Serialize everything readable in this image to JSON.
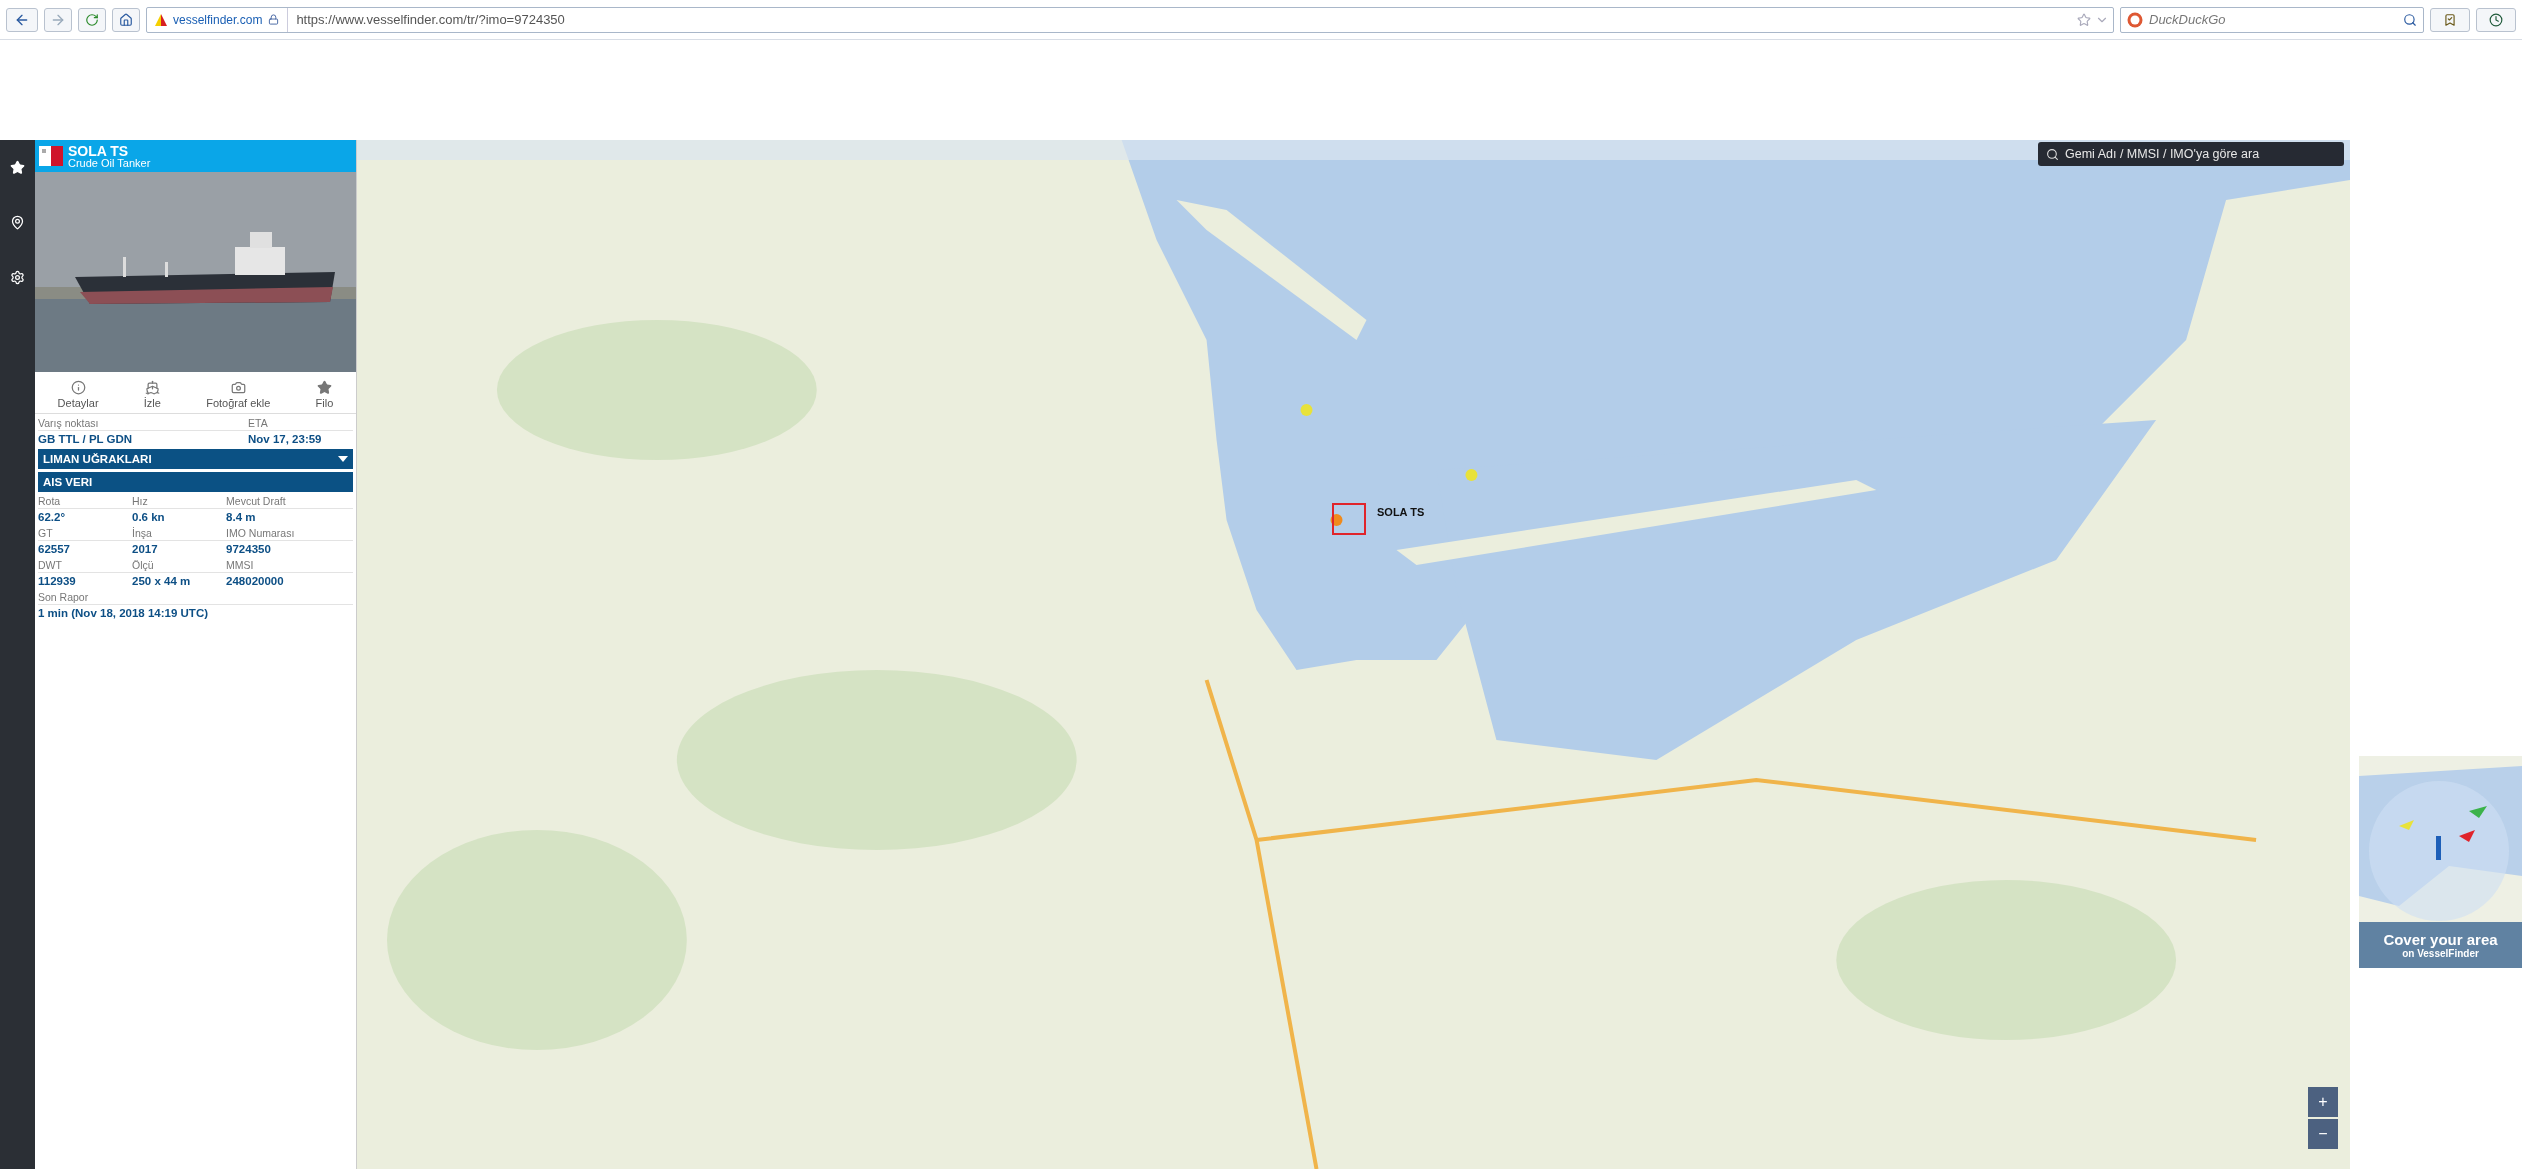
{
  "browser": {
    "site": "vesselfinder.com",
    "url": "https://www.vesselfinder.com/tr/?imo=9724350",
    "search_placeholder": "DuckDuckGo"
  },
  "vessel": {
    "name": "SOLA TS",
    "type": "Crude Oil Tanker",
    "photo": {
      "kind": "picture"
    },
    "actions": [
      "Detaylar",
      "İzle",
      "Fotoğraf ekle",
      "Filo"
    ],
    "voyage": [
      {
        "label": "Varış noktası",
        "value": "GB TTL / PL GDN"
      },
      {
        "label": "ETA",
        "value": "Nov 17, 23:59"
      }
    ],
    "sections": [
      {
        "title": "LIMAN UĞRAKLARI",
        "expanded": false
      },
      {
        "title": "AIS VERI",
        "expanded": true
      }
    ],
    "ais_rows": [
      [
        {
          "label": "Rota",
          "value": "62.2°"
        },
        {
          "label": "Hız",
          "value": "0.6 kn"
        },
        {
          "label": "Mevcut Draft",
          "value": "8.4 m"
        }
      ],
      [
        {
          "label": "GT",
          "value": "62557"
        },
        {
          "label": "İnşa",
          "value": "2017"
        },
        {
          "label": "IMO Numarası",
          "value": "9724350"
        }
      ],
      [
        {
          "label": "DWT",
          "value": "112939"
        },
        {
          "label": "Ölçü",
          "value": "250 x 44 m"
        },
        {
          "label": "MMSI",
          "value": "248020000"
        }
      ],
      [
        {
          "label": "Son Rapor",
          "value": "1 min (Nov 18, 2018 14:19 UTC)"
        }
      ]
    ]
  },
  "map": {
    "search_placeholder": "Gemi Adı / MMSI / IMO'ya göre ara",
    "selected_label": "SOLA TS",
    "zoom_buttons": [
      "+",
      "−"
    ]
  },
  "ad": {
    "title": "Cover your area",
    "subtitle": "on VesselFinder"
  }
}
